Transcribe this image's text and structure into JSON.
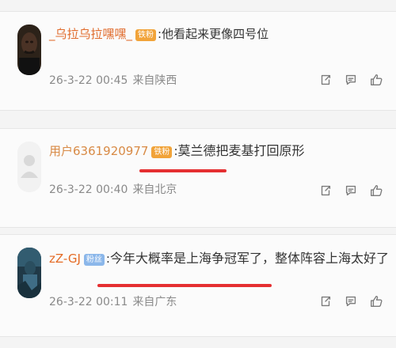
{
  "comments": [
    {
      "username": "_乌拉乌拉嘿嘿_",
      "badge": "铁粉",
      "separator": ":",
      "text": "他看起来更像四号位",
      "date": "26-3-22 00:45",
      "location": "来自陕西",
      "underline": false,
      "avatar_style": "dark-portrait"
    },
    {
      "username": "用户6361920977",
      "badge": "铁粉",
      "separator": ":",
      "text": "莫兰德把麦基打回原形",
      "date": "26-3-22 00:40",
      "location": "来自北京",
      "underline": true,
      "avatar_style": "default"
    },
    {
      "username": "zZ-GJ",
      "badge": "粉丝",
      "separator": ":",
      "text": "今年大概率是上海争冠军了，整体阵容上海太好了",
      "date": "26-3-22 00:11",
      "location": "来自广东",
      "underline": true,
      "avatar_style": "blue-portrait"
    }
  ],
  "icons": [
    "share-icon",
    "comment-icon",
    "like-icon"
  ],
  "colors": {
    "username_orange": "#e06a2a",
    "badge_orange": "#f1a339",
    "badge_blue": "#8bb7ea",
    "meta_gray": "#8a8a8a",
    "highlight_red": "#e52f31"
  }
}
